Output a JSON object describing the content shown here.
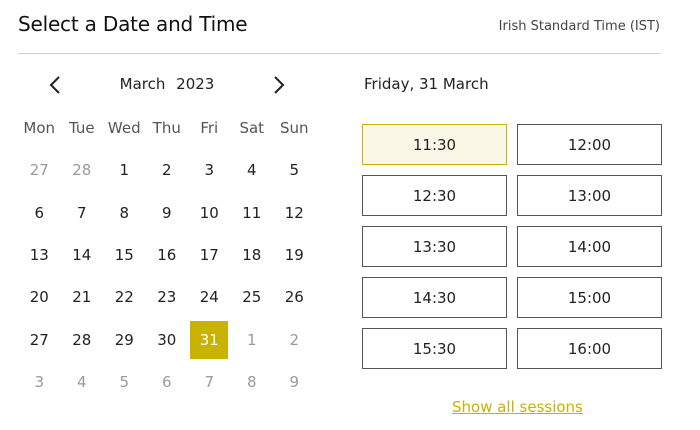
{
  "header": {
    "title": "Select a Date and Time",
    "timezone": "Irish Standard Time (IST)"
  },
  "calendar": {
    "month_label": "March   2023",
    "weekdays": [
      "Mon",
      "Tue",
      "Wed",
      "Thu",
      "Fri",
      "Sat",
      "Sun"
    ],
    "days": [
      {
        "label": "27",
        "muted": true
      },
      {
        "label": "28",
        "muted": true
      },
      {
        "label": "1"
      },
      {
        "label": "2"
      },
      {
        "label": "3"
      },
      {
        "label": "4"
      },
      {
        "label": "5"
      },
      {
        "label": "6"
      },
      {
        "label": "7"
      },
      {
        "label": "8"
      },
      {
        "label": "9"
      },
      {
        "label": "10"
      },
      {
        "label": "11"
      },
      {
        "label": "12"
      },
      {
        "label": "13"
      },
      {
        "label": "14"
      },
      {
        "label": "15"
      },
      {
        "label": "16"
      },
      {
        "label": "17"
      },
      {
        "label": "18"
      },
      {
        "label": "19"
      },
      {
        "label": "20"
      },
      {
        "label": "21"
      },
      {
        "label": "22"
      },
      {
        "label": "23"
      },
      {
        "label": "24"
      },
      {
        "label": "25"
      },
      {
        "label": "26"
      },
      {
        "label": "27"
      },
      {
        "label": "28"
      },
      {
        "label": "29"
      },
      {
        "label": "30"
      },
      {
        "label": "31",
        "selected": true
      },
      {
        "label": "1",
        "muted": true
      },
      {
        "label": "2",
        "muted": true
      },
      {
        "label": "3",
        "muted": true
      },
      {
        "label": "4",
        "muted": true
      },
      {
        "label": "5",
        "muted": true
      },
      {
        "label": "6",
        "muted": true
      },
      {
        "label": "7",
        "muted": true
      },
      {
        "label": "8",
        "muted": true
      },
      {
        "label": "9",
        "muted": true
      }
    ]
  },
  "sessions": {
    "date_heading": "Friday, 31 March",
    "slots": [
      {
        "time": "11:30",
        "selected": true
      },
      {
        "time": "12:00"
      },
      {
        "time": "12:30"
      },
      {
        "time": "13:00"
      },
      {
        "time": "13:30"
      },
      {
        "time": "14:00"
      },
      {
        "time": "14:30"
      },
      {
        "time": "15:00"
      },
      {
        "time": "15:30"
      },
      {
        "time": "16:00"
      }
    ],
    "show_all_label": "Show all sessions"
  },
  "colors": {
    "accent": "#c9b200",
    "selected_slot_bg": "#faf7e6"
  },
  "icons": {
    "prev": "chevron-left-icon",
    "next": "chevron-right-icon"
  }
}
